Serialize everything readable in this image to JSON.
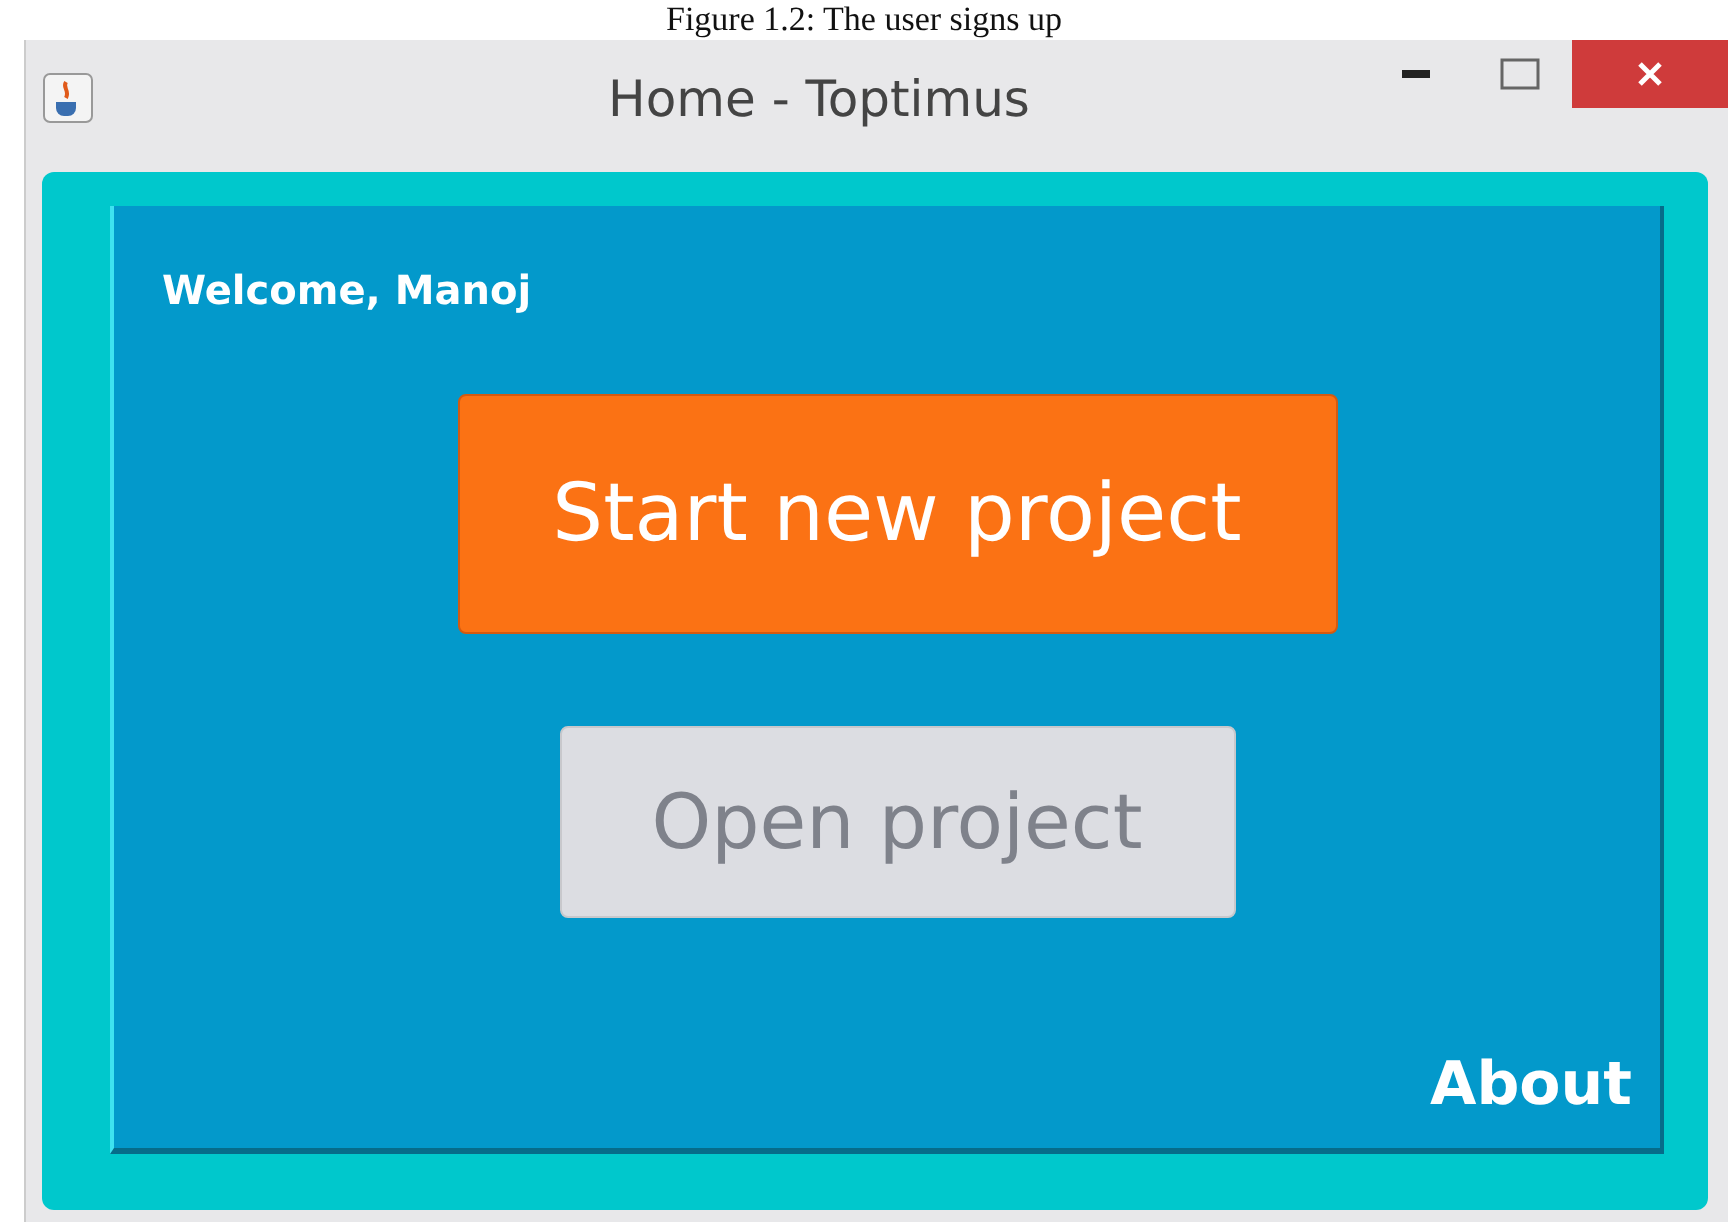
{
  "caption": "Figure 1.2: The user signs up",
  "window": {
    "title": "Home - Toptimus"
  },
  "welcome": "Welcome, Manoj",
  "buttons": [
    {
      "label": "Start new project",
      "kind": "primary",
      "disabled": false
    },
    {
      "label": "Open project",
      "kind": "secondary",
      "disabled": true
    }
  ],
  "about_link": "About"
}
